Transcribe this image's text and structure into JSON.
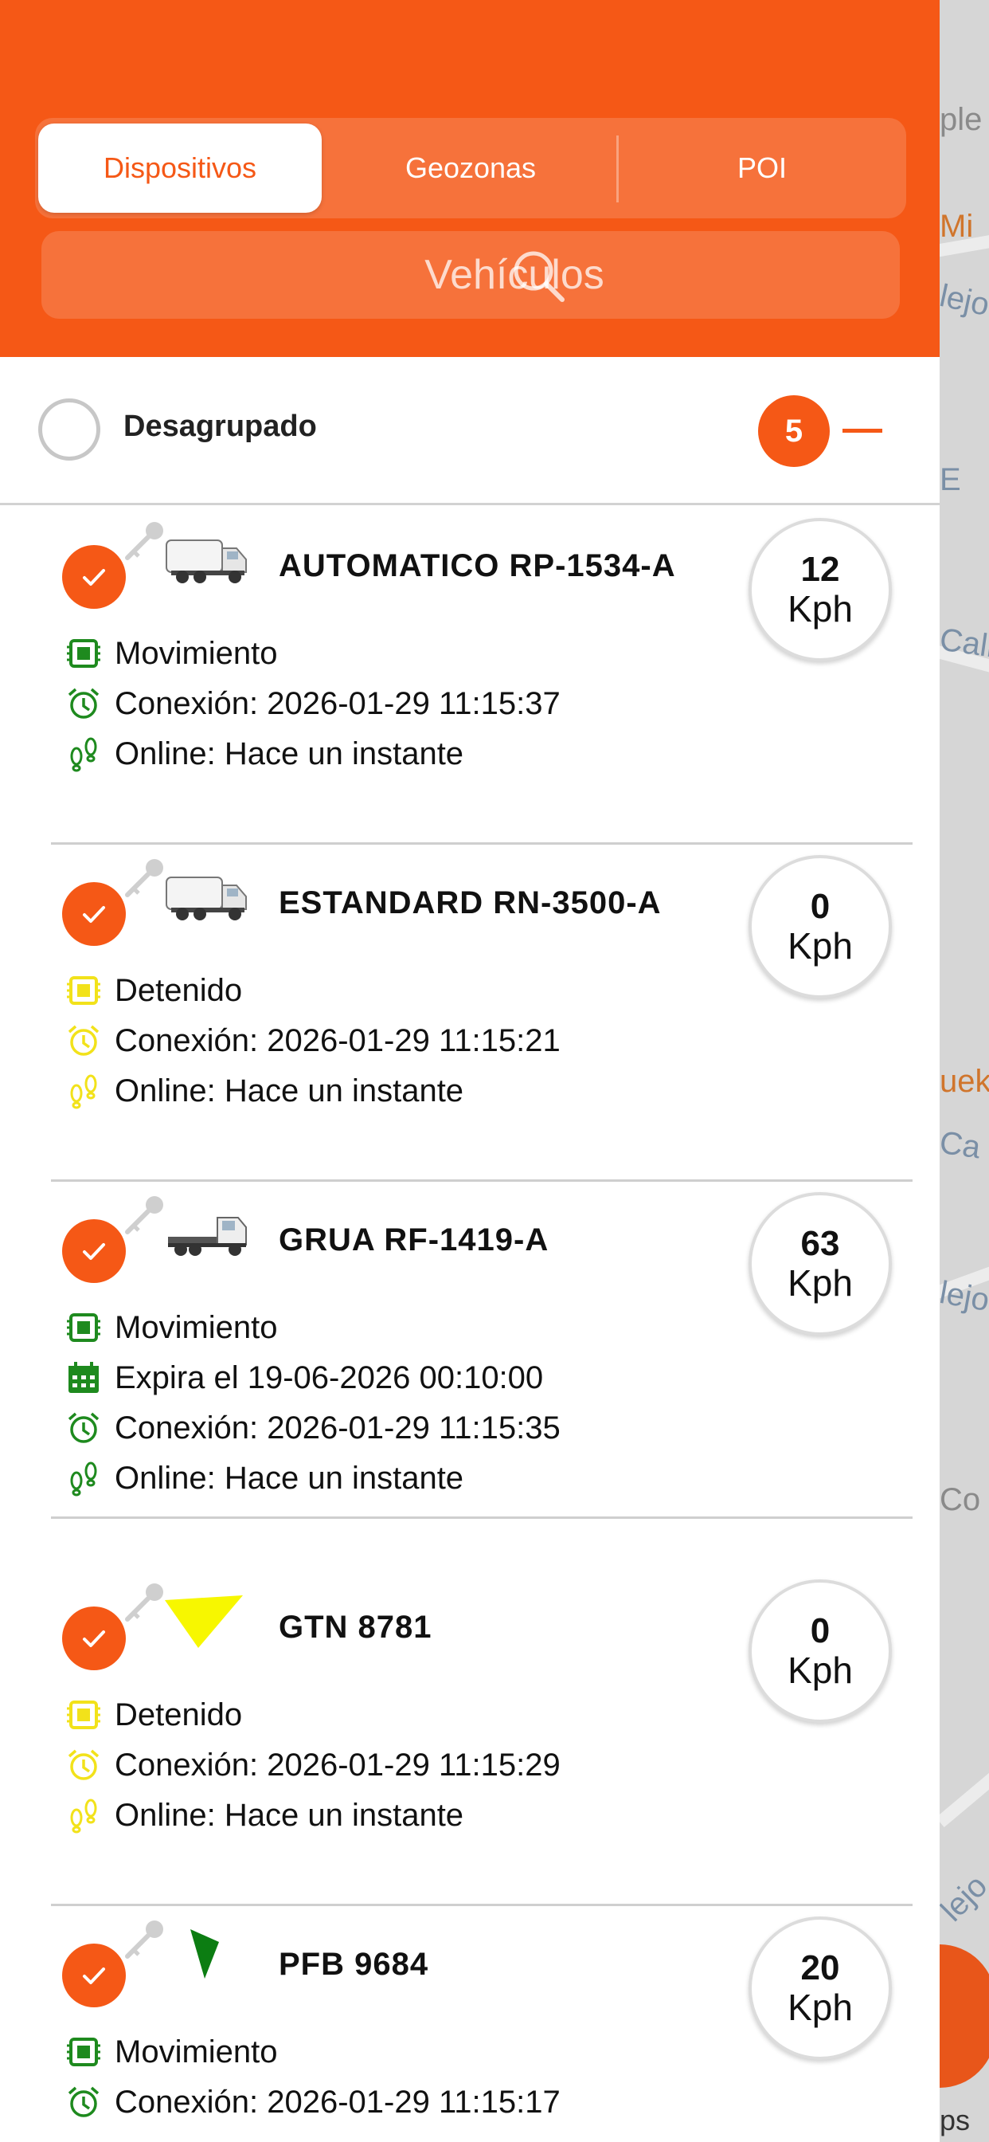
{
  "tabs": [
    {
      "label": "Dispositivos",
      "active": true
    },
    {
      "label": "Geozonas",
      "active": false
    },
    {
      "label": "POI",
      "active": false
    }
  ],
  "search": {
    "placeholder": "Vehículos"
  },
  "group": {
    "label": "Desagrupado",
    "count": "5"
  },
  "colors": {
    "accent": "#f55816",
    "moving": "#1e8a1e",
    "stopped": "#f2e21a"
  },
  "vehicles": [
    {
      "name": "AUTOMATICO RP-1534-A",
      "speed": "12",
      "unit": "Kph",
      "status_color": "moving",
      "icon": "garbage-truck-icon",
      "rows": [
        {
          "icon": "chip-icon",
          "text": "Movimiento"
        },
        {
          "icon": "alarm-clock-icon",
          "text": "Conexión: 2026-01-29 11:15:37"
        },
        {
          "icon": "footprints-icon",
          "text": "Online: Hace un instante"
        }
      ]
    },
    {
      "name": "ESTANDARD RN-3500-A",
      "speed": "0",
      "unit": "Kph",
      "status_color": "stopped",
      "icon": "garbage-truck-icon",
      "rows": [
        {
          "icon": "chip-icon",
          "text": "Detenido"
        },
        {
          "icon": "alarm-clock-icon",
          "text": "Conexión: 2026-01-29 11:15:21"
        },
        {
          "icon": "footprints-icon",
          "text": "Online: Hace un instante"
        }
      ]
    },
    {
      "name": "GRUA RF-1419-A",
      "speed": "63",
      "unit": "Kph",
      "status_color": "moving",
      "icon": "tow-truck-icon",
      "rows": [
        {
          "icon": "chip-icon",
          "text": "Movimiento"
        },
        {
          "icon": "calendar-icon",
          "text": "Expira el 19-06-2026 00:10:00"
        },
        {
          "icon": "alarm-clock-icon",
          "text": "Conexión: 2026-01-29 11:15:35"
        },
        {
          "icon": "footprints-icon",
          "text": "Online: Hace un instante"
        }
      ]
    },
    {
      "name": "GTN 8781",
      "speed": "0",
      "unit": "Kph",
      "status_color": "stopped",
      "icon": "yellow-arrow-icon",
      "rows": [
        {
          "icon": "chip-icon",
          "text": "Detenido"
        },
        {
          "icon": "alarm-clock-icon",
          "text": "Conexión: 2026-01-29 11:15:29"
        },
        {
          "icon": "footprints-icon",
          "text": "Online: Hace un instante"
        }
      ]
    },
    {
      "name": "PFB 9684",
      "speed": "20",
      "unit": "Kph",
      "status_color": "moving",
      "icon": "green-arrow-icon",
      "rows": [
        {
          "icon": "chip-icon",
          "text": "Movimiento"
        },
        {
          "icon": "alarm-clock-icon",
          "text": "Conexión: 2026-01-29 11:15:17"
        }
      ]
    }
  ],
  "map": {
    "labels": [
      "ple",
      "Mi",
      "lejo",
      "E",
      "Call",
      "uek",
      "Ca",
      "lejo",
      "Co",
      "lejo",
      "ps"
    ]
  }
}
